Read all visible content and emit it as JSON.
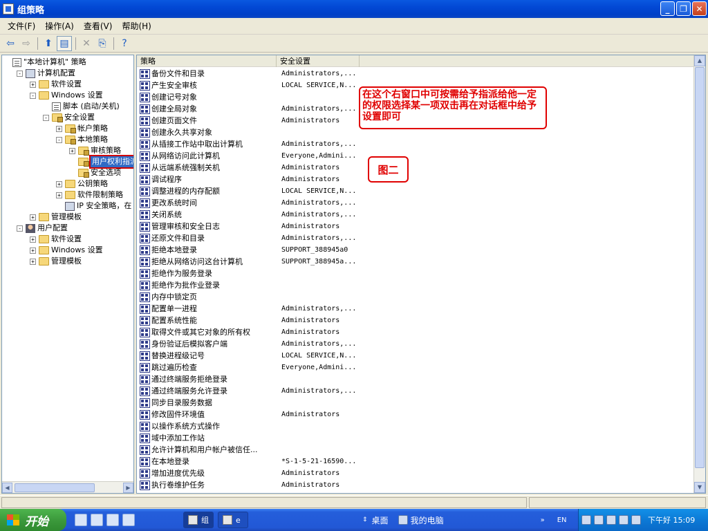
{
  "window": {
    "title": "组策略"
  },
  "menu": [
    "文件(F)",
    "操作(A)",
    "查看(V)",
    "帮助(H)"
  ],
  "toolbar": {
    "icons": [
      "back-arrow-icon",
      "forward-arrow-icon",
      "up-folder-icon",
      "show-tree-icon",
      "delete-icon",
      "export-list-icon",
      "help-icon"
    ]
  },
  "tree": [
    {
      "label": "\"本地计算机\" 策略",
      "icon": "doc",
      "indent": 0,
      "expander": "none"
    },
    {
      "label": "计算机配置",
      "icon": "pc",
      "indent": 1,
      "expander": "-"
    },
    {
      "label": "软件设置",
      "icon": "folder",
      "indent": 2,
      "expander": "+"
    },
    {
      "label": "Windows 设置",
      "icon": "folder",
      "indent": 2,
      "expander": "-"
    },
    {
      "label": "脚本 (启动/关机)",
      "icon": "doc",
      "indent": 3,
      "expander": "none"
    },
    {
      "label": "安全设置",
      "icon": "lock",
      "indent": 3,
      "expander": "-"
    },
    {
      "label": "帐户策略",
      "icon": "lock",
      "indent": 4,
      "expander": "+"
    },
    {
      "label": "本地策略",
      "icon": "lock",
      "indent": 4,
      "expander": "-"
    },
    {
      "label": "审核策略",
      "icon": "lock",
      "indent": 5,
      "expander": "+"
    },
    {
      "label": "用户权利指派",
      "icon": "lock",
      "indent": 5,
      "expander": "none",
      "selected": true
    },
    {
      "label": "安全选项",
      "icon": "lock",
      "indent": 5,
      "expander": "none"
    },
    {
      "label": "公钥策略",
      "icon": "folder",
      "indent": 4,
      "expander": "+"
    },
    {
      "label": "软件限制策略",
      "icon": "folder",
      "indent": 4,
      "expander": "+"
    },
    {
      "label": "IP 安全策略，在",
      "icon": "pc",
      "indent": 4,
      "expander": "none"
    },
    {
      "label": "管理模板",
      "icon": "folder",
      "indent": 2,
      "expander": "+"
    },
    {
      "label": "用户配置",
      "icon": "user",
      "indent": 1,
      "expander": "-"
    },
    {
      "label": "软件设置",
      "icon": "folder",
      "indent": 2,
      "expander": "+"
    },
    {
      "label": "Windows 设置",
      "icon": "folder",
      "indent": 2,
      "expander": "+"
    },
    {
      "label": "管理模板",
      "icon": "folder",
      "indent": 2,
      "expander": "+"
    }
  ],
  "list": {
    "columns": [
      "策略",
      "安全设置"
    ],
    "rows": [
      [
        "备份文件和目录",
        "Administrators,..."
      ],
      [
        "产生安全审核",
        "LOCAL SERVICE,N..."
      ],
      [
        "创建记号对象",
        ""
      ],
      [
        "创建全局对象",
        "Administrators,..."
      ],
      [
        "创建页面文件",
        "Administrators"
      ],
      [
        "创建永久共享对象",
        ""
      ],
      [
        "从插接工作站中取出计算机",
        "Administrators,..."
      ],
      [
        "从网络访问此计算机",
        "Everyone,Admini..."
      ],
      [
        "从远端系统强制关机",
        "Administrators"
      ],
      [
        "调试程序",
        "Administrators"
      ],
      [
        "调整进程的内存配额",
        "LOCAL SERVICE,N..."
      ],
      [
        "更改系统时间",
        "Administrators,..."
      ],
      [
        "关闭系统",
        "Administrators,..."
      ],
      [
        "管理审核和安全日志",
        "Administrators"
      ],
      [
        "还原文件和目录",
        "Administrators,..."
      ],
      [
        "拒绝本地登录",
        "SUPPORT_388945a0"
      ],
      [
        "拒绝从网络访问这台计算机",
        "SUPPORT_388945a..."
      ],
      [
        "拒绝作为服务登录",
        ""
      ],
      [
        "拒绝作为批作业登录",
        ""
      ],
      [
        "内存中锁定页",
        ""
      ],
      [
        "配置单一进程",
        "Administrators,..."
      ],
      [
        "配置系统性能",
        "Administrators"
      ],
      [
        "取得文件或其它对象的所有权",
        "Administrators"
      ],
      [
        "身份验证后模拟客户端",
        "Administrators,..."
      ],
      [
        "替换进程级记号",
        "LOCAL SERVICE,N..."
      ],
      [
        "跳过遍历检查",
        "Everyone,Admini..."
      ],
      [
        "通过终端服务拒绝登录",
        ""
      ],
      [
        "通过终端服务允许登录",
        "Administrators,..."
      ],
      [
        "同步目录服务数据",
        ""
      ],
      [
        "修改固件环境值",
        "Administrators"
      ],
      [
        "以操作系统方式操作",
        ""
      ],
      [
        "域中添加工作站",
        ""
      ],
      [
        "允许计算机和用户帐户被信任...",
        ""
      ],
      [
        "在本地登录",
        "*S-1-5-21-16590..."
      ],
      [
        "增加进度优先级",
        "Administrators"
      ],
      [
        "执行卷维护任务",
        "Administrators"
      ]
    ]
  },
  "annotations": {
    "note1": "在这个右窗口中可按需给予指派给他一定的权限选择某一项双击再在对话框中给予设置即可",
    "note2": "图二"
  },
  "taskbar": {
    "start": "开始",
    "tasks": [
      "组",
      "e"
    ],
    "toolbar_items": [
      "桌面",
      "我的电脑"
    ],
    "lang": "EN",
    "clock": "下午好 15:09"
  }
}
